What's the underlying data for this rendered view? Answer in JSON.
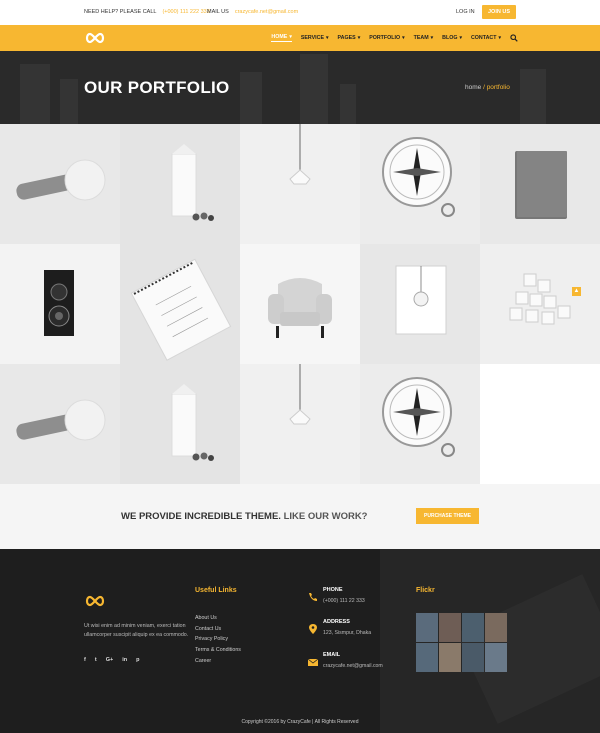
{
  "topbar": {
    "help_label": "NEED HELP? PLEASE CALL",
    "help_phone": "(+000) 111 222 333",
    "mail_label": "MAIL US",
    "mail_value": "crazycafe.net@gmail.com",
    "login": "LOG IN",
    "join": "JOIN US"
  },
  "nav": {
    "items": [
      {
        "label": "HOME",
        "active": true
      },
      {
        "label": "SERVICE"
      },
      {
        "label": "PAGES"
      },
      {
        "label": "PORTFOLIO"
      },
      {
        "label": "TEAM"
      },
      {
        "label": "BLOG"
      },
      {
        "label": "CONTACT"
      }
    ]
  },
  "hero": {
    "title": "OUR PORTFOLIO",
    "crumb_home": "home",
    "crumb_sep": " / ",
    "crumb_current": "portfolio"
  },
  "portfolio": {
    "items": [
      "microphone",
      "milk-carton",
      "pendant-lamp",
      "compass",
      "notebook",
      "camera",
      "sketchbook",
      "armchair",
      "light-bulb-frame",
      "cubes",
      "microphone",
      "milk-carton",
      "pendant-lamp",
      "compass"
    ]
  },
  "cta": {
    "message_bold": "WE PROVIDE INCREDIBLE THEME.",
    "message_light": " LIKE OUR WORK?",
    "button": "PURCHASE THEME"
  },
  "footer": {
    "about": "Ut wisi enim ad minim veniam, exerci tation ullamcorper suscipit aliquip ex ea commodo.",
    "social": [
      "f",
      "t",
      "G+",
      "in",
      "p"
    ],
    "useful_title": "Useful Links",
    "links": [
      "About Us",
      "Contact Us",
      "Privacy Policy",
      "Terms & Conditions",
      "Career"
    ],
    "phone_label": "PHONE",
    "phone_value": "(+000) 111 22 333",
    "address_label": "ADDRESS",
    "address_value": "123, Sismpur, Dhaka",
    "email_label": "EMAIL",
    "email_value": "crazycafe.net@gmail.com",
    "flickr_title": "Flickr",
    "copyright": "Copyright ©2016 by CrazyCafe  |  All Rights Reserved"
  },
  "colors": {
    "accent": "#f7b731",
    "dark": "#1e1e1e"
  }
}
